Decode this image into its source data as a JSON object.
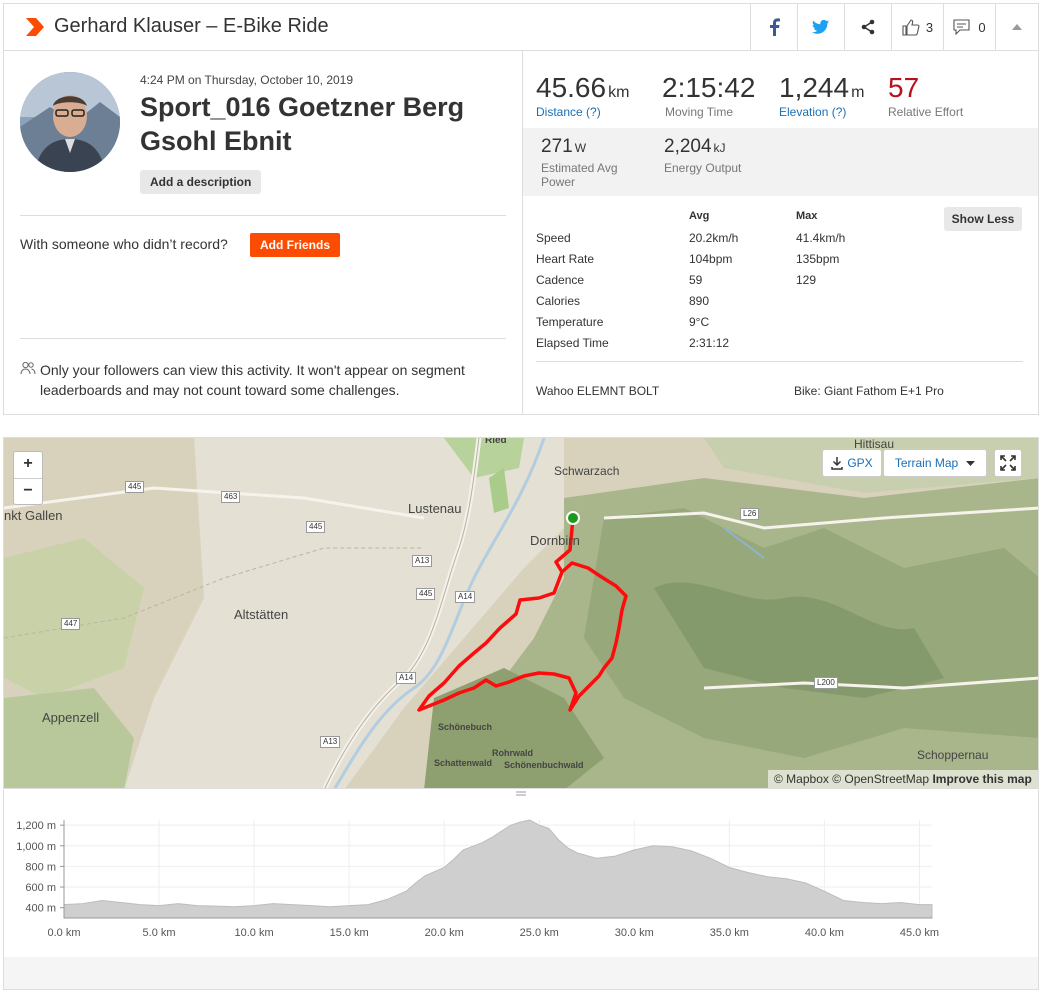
{
  "header": {
    "title": "Gerhard Klauser – E-Bike Ride",
    "kudos_count": "3",
    "comment_count": "0"
  },
  "activity": {
    "datetime": "4:24 PM on Thursday, October 10, 2019",
    "name": "Sport_016 Goetzner Berg Gsohl Ebnit",
    "add_description_label": "Add a description",
    "with_someone_text": "With someone who didn’t record?",
    "add_friends_label": "Add Friends",
    "privacy_text": "Only your followers can view this activity. It won't appear on segment leaderboards and may not count toward some challenges."
  },
  "stats": {
    "distance": {
      "value": "45.66",
      "unit": "km",
      "label": "Distance (?)"
    },
    "moving_time": {
      "value": "2:15:42",
      "label": "Moving Time"
    },
    "elevation": {
      "value": "1,244",
      "unit": "m",
      "label": "Elevation (?)"
    },
    "relative_effort": {
      "value": "57",
      "label": "Relative Effort"
    },
    "power": {
      "value": "271",
      "unit": "W",
      "label_line1": "Estimated Avg",
      "label_line2": "Power"
    },
    "energy": {
      "value": "2,204",
      "unit": "kJ",
      "label": "Energy Output"
    }
  },
  "table": {
    "col_avg": "Avg",
    "col_max": "Max",
    "show_less_label": "Show Less",
    "rows": [
      {
        "label": "Speed",
        "avg": "20.2km/h",
        "max": "41.4km/h"
      },
      {
        "label": "Heart Rate",
        "avg": "104bpm",
        "max": "135bpm"
      },
      {
        "label": "Cadence",
        "avg": "59",
        "max": "129"
      },
      {
        "label": "Calories",
        "avg": "890",
        "max": ""
      },
      {
        "label": "Temperature",
        "avg": "9°C",
        "max": ""
      },
      {
        "label": "Elapsed Time",
        "avg": "2:31:12",
        "max": ""
      }
    ],
    "device": "Wahoo ELEMNT BOLT",
    "bike": "Bike: Giant Fathom E+1 Pro"
  },
  "map": {
    "zoom_in": "+",
    "zoom_out": "−",
    "gpx_label": "GPX",
    "terrain_label": "Terrain Map",
    "attribution": "© Mapbox © OpenStreetMap",
    "improve_label": "Improve this map",
    "places": [
      "Ried",
      "Hittisau",
      "Schwarzach",
      "Lustenau",
      "Dornbirn",
      "nkt Gallen",
      "Altstätten",
      "Appenzell",
      "Schönebuch",
      "Rohrwald",
      "Schattenwald",
      "Schönenbuchwald",
      "Schoppernau"
    ],
    "roads": [
      "445",
      "463",
      "445",
      "A13",
      "445",
      "A14",
      "447",
      "A14",
      "A13",
      "L26",
      "L200"
    ]
  },
  "elevation_chart": {
    "type": "area",
    "ylabel": "",
    "xlabel": "",
    "y_ticks": [
      "1,200 m",
      "1,000 m",
      "800 m",
      "600 m",
      "400 m"
    ],
    "x_ticks": [
      "0.0 km",
      "5.0 km",
      "10.0 km",
      "15.0 km",
      "20.0 km",
      "25.0 km",
      "30.0 km",
      "35.0 km",
      "40.0 km",
      "45.0 km"
    ],
    "xlim": [
      0,
      45.66
    ],
    "ylim": [
      300,
      1250
    ],
    "x": [
      0,
      1,
      2,
      3,
      4,
      5,
      6,
      7,
      8,
      9,
      10,
      11,
      12,
      13,
      14,
      15,
      16,
      17,
      18,
      18.5,
      19,
      20,
      20.5,
      21,
      22,
      22.5,
      23,
      23.5,
      24,
      24.5,
      25,
      25.5,
      26,
      26.5,
      27,
      28,
      29,
      30,
      31,
      32,
      33,
      34,
      35,
      36,
      37,
      38,
      39,
      40,
      41,
      42,
      43,
      44,
      45,
      45.66
    ],
    "y": [
      430,
      440,
      470,
      450,
      430,
      420,
      440,
      420,
      415,
      410,
      420,
      440,
      430,
      420,
      410,
      420,
      430,
      480,
      560,
      640,
      710,
      790,
      870,
      960,
      1030,
      1080,
      1140,
      1200,
      1230,
      1250,
      1200,
      1170,
      1060,
      980,
      930,
      880,
      900,
      960,
      1000,
      990,
      950,
      880,
      790,
      740,
      700,
      680,
      640,
      560,
      470,
      450,
      440,
      450,
      430,
      430
    ]
  }
}
